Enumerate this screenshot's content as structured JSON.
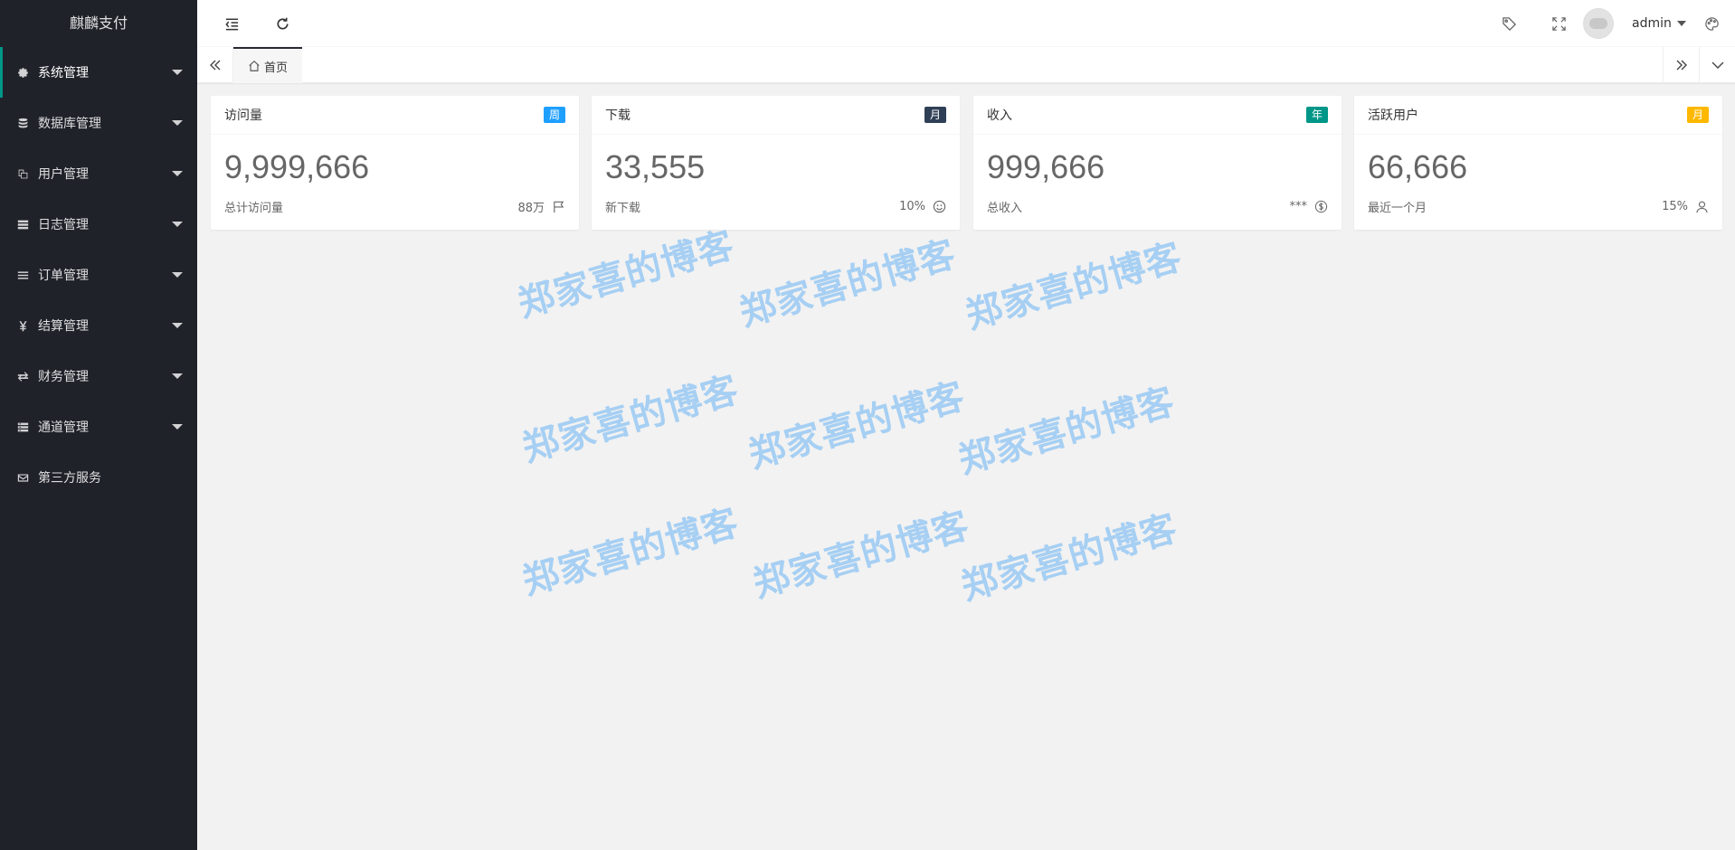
{
  "app": {
    "title": "麒麟支付"
  },
  "sidebar": {
    "items": [
      {
        "label": "系统管理",
        "icon": "gear-icon",
        "active": true,
        "has_children": true
      },
      {
        "label": "数据库管理",
        "icon": "database-icon",
        "active": false,
        "has_children": true
      },
      {
        "label": "用户管理",
        "icon": "users-icon",
        "active": false,
        "has_children": true
      },
      {
        "label": "日志管理",
        "icon": "server-icon",
        "active": false,
        "has_children": true
      },
      {
        "label": "订单管理",
        "icon": "list-icon",
        "active": false,
        "has_children": true
      },
      {
        "label": "结算管理",
        "icon": "yen-icon",
        "active": false,
        "has_children": true
      },
      {
        "label": "财务管理",
        "icon": "exchange-icon",
        "active": false,
        "has_children": true
      },
      {
        "label": "通道管理",
        "icon": "tasks-icon",
        "active": false,
        "has_children": true
      },
      {
        "label": "第三方服务",
        "icon": "envelope-icon",
        "active": false,
        "has_children": false
      }
    ]
  },
  "header": {
    "username": "admin"
  },
  "tabs": {
    "home_label": "首页"
  },
  "cards": [
    {
      "title": "访问量",
      "badge": "周",
      "badge_color": "#1e9fff",
      "value": "9,999,666",
      "caption": "总计访问量",
      "meta": "88万",
      "icon": "flag-icon"
    },
    {
      "title": "下载",
      "badge": "月",
      "badge_color": "#2f4056",
      "value": "33,555",
      "caption": "新下载",
      "meta": "10%",
      "icon": "smile-icon"
    },
    {
      "title": "收入",
      "badge": "年",
      "badge_color": "#009688",
      "value": "999,666",
      "caption": "总收入",
      "meta": "***",
      "icon": "dollar-icon"
    },
    {
      "title": "活跃用户",
      "badge": "月",
      "badge_color": "#ffb800",
      "value": "66,666",
      "caption": "最近一个月",
      "meta": "15%",
      "icon": "user-icon"
    }
  ],
  "watermark": {
    "text": "郑家喜的博客"
  },
  "colors": {
    "sidebar_bg": "#20222a",
    "active_accent": "#009688",
    "watermark": "#a6cff3"
  }
}
